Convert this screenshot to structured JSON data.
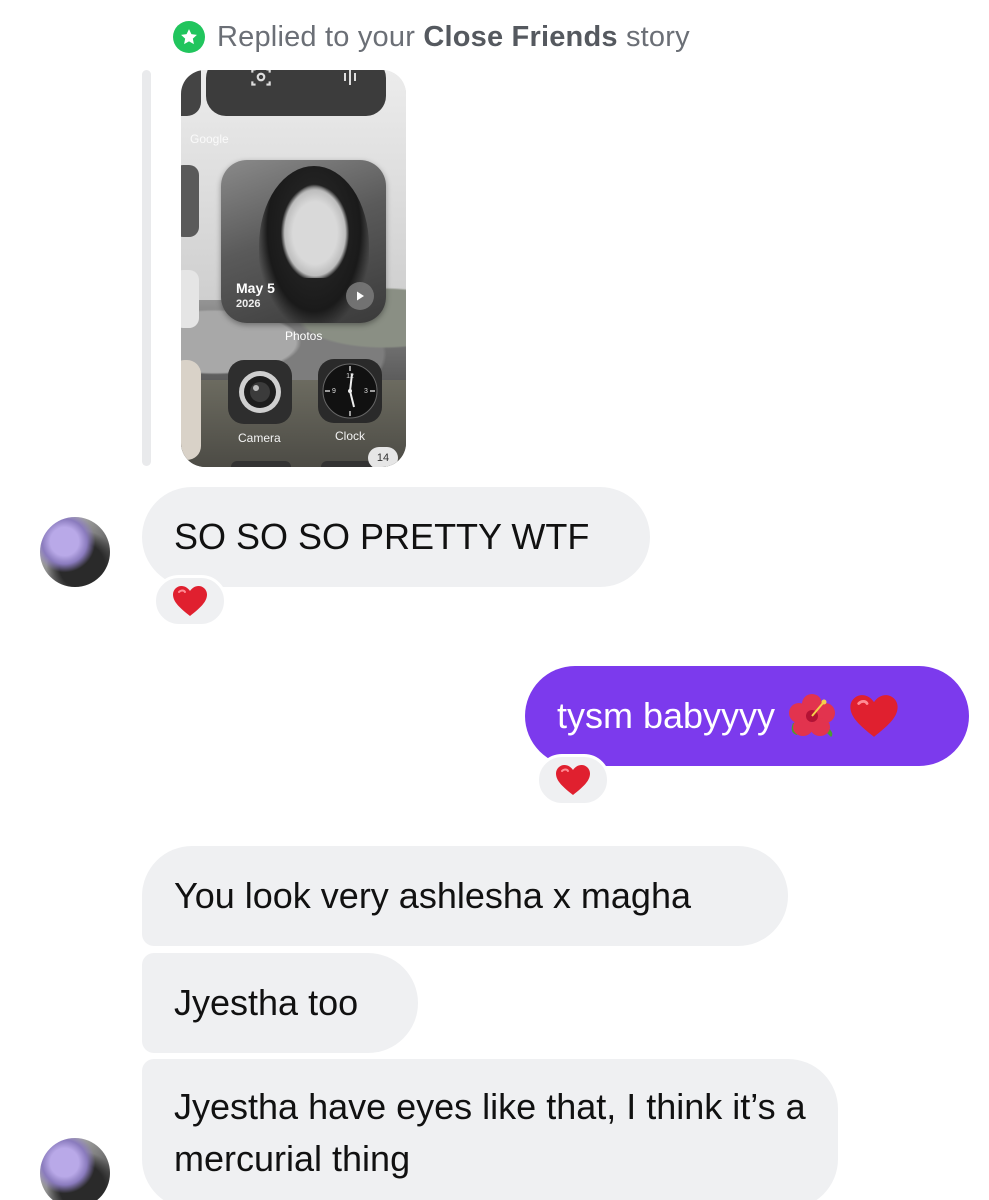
{
  "reply_header": {
    "prefix": "Replied to your",
    "story_type": "Close Friends",
    "suffix": "story"
  },
  "story_preview": {
    "widget_label": "Google",
    "photo_date": "May 5",
    "photo_year": "2026",
    "photos_label": "Photos",
    "camera_label": "Camera",
    "clock_label": "Clock",
    "badge_text": "14",
    "clock_12": "12",
    "clock_3": "3",
    "clock_9": "9"
  },
  "messages": [
    {
      "id": "m1",
      "direction": "incoming",
      "text": "SO SO SO PRETTY WTF",
      "reaction": "heart"
    },
    {
      "id": "m2",
      "direction": "outgoing",
      "text": "tysm babyyyy",
      "emoji": [
        "hibiscus",
        "heart"
      ],
      "reaction": "heart"
    },
    {
      "id": "m3",
      "direction": "incoming",
      "text": "You look very ashlesha x magha"
    },
    {
      "id": "m4",
      "direction": "incoming",
      "text": "Jyestha too"
    },
    {
      "id": "m5",
      "direction": "incoming",
      "text": "Jyestha have eyes like that, I think it’s a mercurial thing"
    }
  ],
  "colors": {
    "outgoing_bubble": "#7c3aed",
    "incoming_bubble": "#eff0f2",
    "close_friends_badge": "#21c55d",
    "reaction_heart": "#e0202f"
  }
}
